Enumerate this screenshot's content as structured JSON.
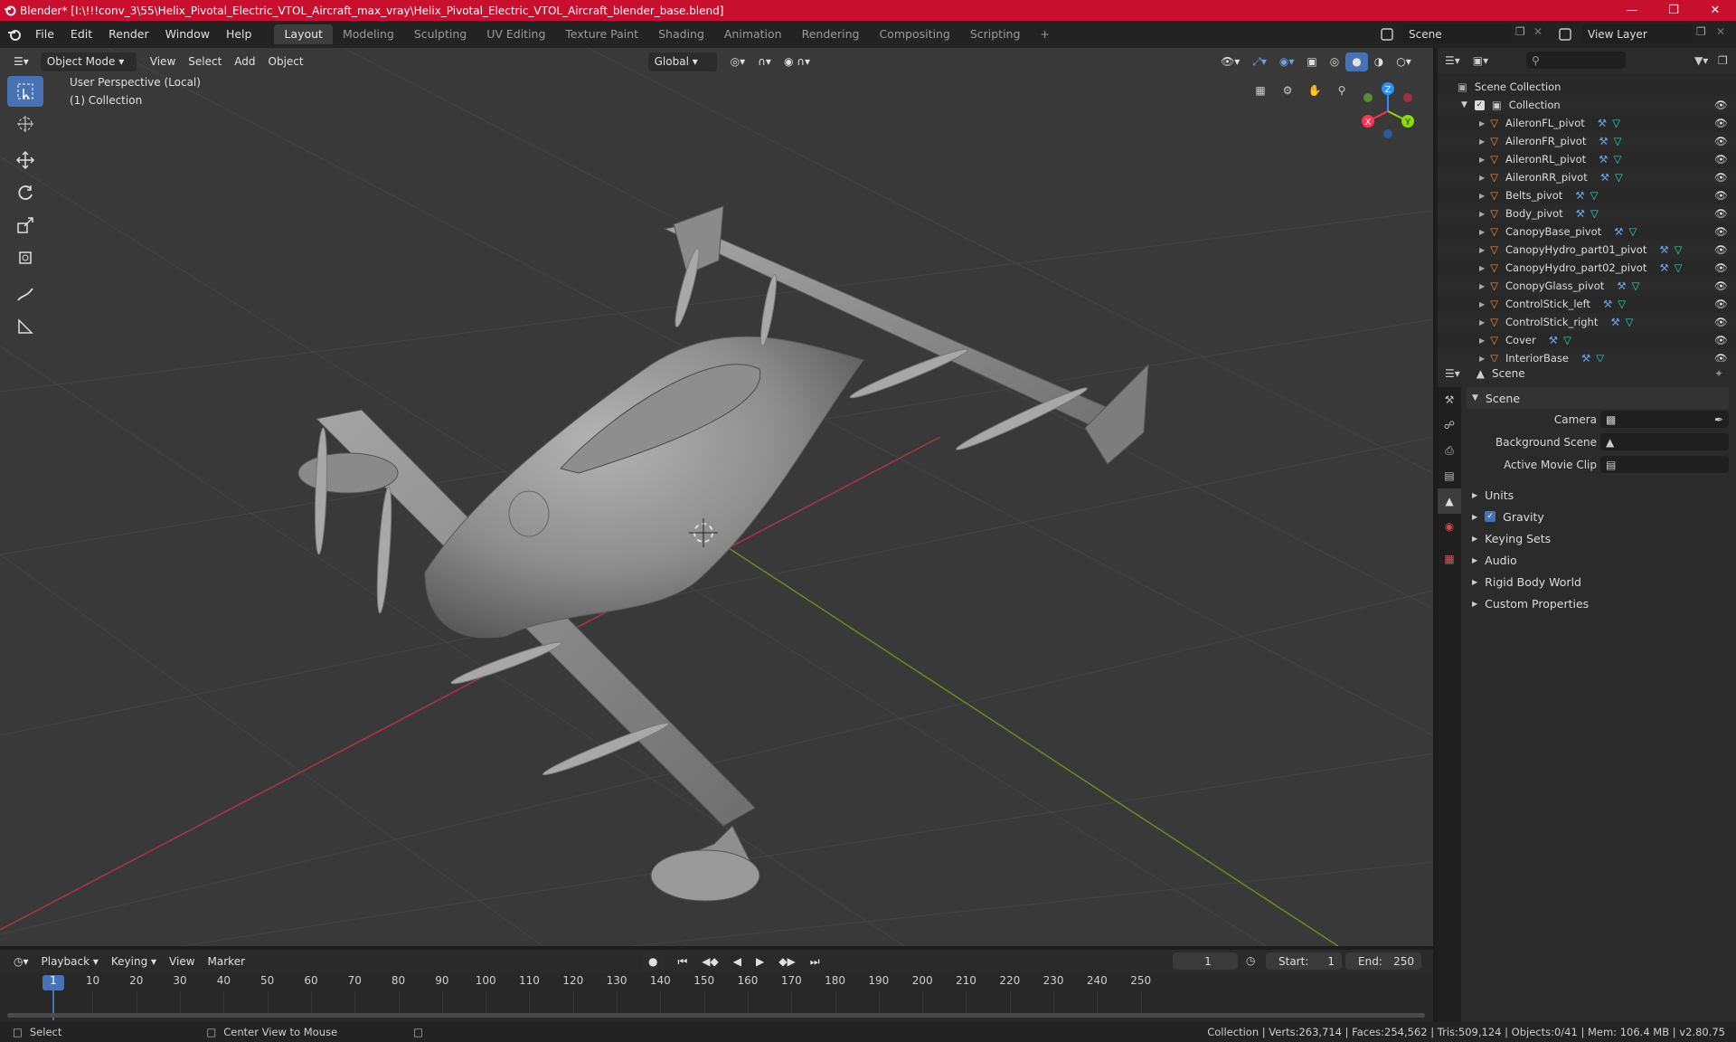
{
  "window": {
    "title": "Blender* [I:\\!!!conv_3\\55\\Helix_Pivotal_Electric_VTOL_Aircraft_max_vray\\Helix_Pivotal_Electric_VTOL_Aircraft_blender_base.blend]"
  },
  "menu": [
    "File",
    "Edit",
    "Render",
    "Window",
    "Help"
  ],
  "workspaces": [
    "Layout",
    "Modeling",
    "Sculpting",
    "UV Editing",
    "Texture Paint",
    "Shading",
    "Animation",
    "Rendering",
    "Compositing",
    "Scripting"
  ],
  "active_workspace": "Layout",
  "scene_field": "Scene",
  "view_layer_field": "View Layer",
  "viewport": {
    "mode": "Object Mode",
    "menus": [
      "View",
      "Select",
      "Add",
      "Object"
    ],
    "orientation": "Global",
    "overlay_line1": "User Perspective (Local)",
    "overlay_line2": "(1) Collection"
  },
  "gizmo": {
    "x": "X",
    "y": "Y",
    "z": "Z"
  },
  "outliner": {
    "root": "Scene Collection",
    "collection": "Collection",
    "items": [
      "AileronFL_pivot",
      "AileronFR_pivot",
      "AileronRL_pivot",
      "AileronRR_pivot",
      "Belts_pivot",
      "Body_pivot",
      "CanopyBase_pivot",
      "CanopyHydro_part01_pivot",
      "CanopyHydro_part02_pivot",
      "ConopyGlass_pivot",
      "ControlStick_left",
      "ControlStick_right",
      "Cover",
      "InteriorBase"
    ]
  },
  "properties": {
    "header": "Scene",
    "panel": "Scene",
    "fields": [
      {
        "label": "Camera",
        "value": ""
      },
      {
        "label": "Background Scene",
        "value": ""
      },
      {
        "label": "Active Movie Clip",
        "value": ""
      }
    ],
    "subpanels": [
      "Units",
      "Gravity",
      "Keying Sets",
      "Audio",
      "Rigid Body World",
      "Custom Properties"
    ],
    "gravity_checked": true
  },
  "timeline": {
    "menus": [
      "Playback",
      "Keying",
      "View",
      "Marker"
    ],
    "current_frame": "1",
    "start_label": "Start:",
    "start": "1",
    "end_label": "End:",
    "end": "250",
    "ticks": [
      "1",
      "10",
      "20",
      "30",
      "40",
      "50",
      "60",
      "70",
      "80",
      "90",
      "100",
      "110",
      "120",
      "130",
      "140",
      "150",
      "160",
      "170",
      "180",
      "190",
      "200",
      "210",
      "220",
      "230",
      "240",
      "250"
    ]
  },
  "status": {
    "left1": "Select",
    "left2": "Center View to Mouse",
    "right": "Collection | Verts:263,714 | Faces:254,562 | Tris:509,124 | Objects:0/41 | Mem: 106.4 MB | v2.80.75"
  },
  "colors": {
    "title_bar": "#c8102e",
    "accent": "#4772b3",
    "x_axis": "#ff3352",
    "y_axis": "#8bdc00",
    "z_axis": "#2890ff"
  }
}
